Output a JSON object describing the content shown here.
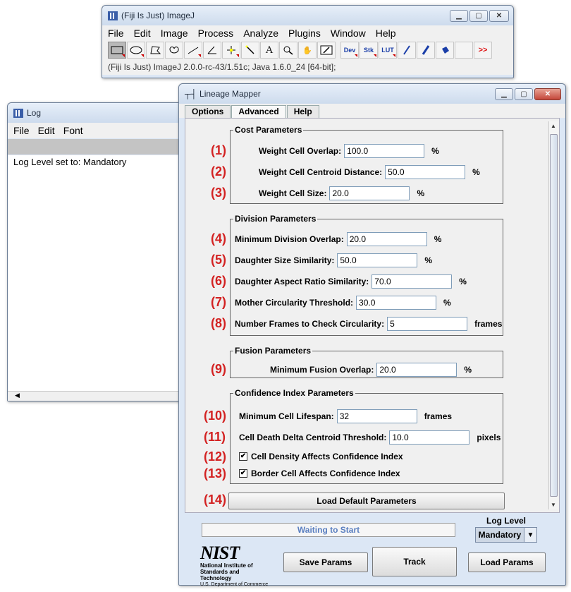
{
  "imagej": {
    "title": "(Fiji Is Just) ImageJ",
    "menu": [
      "File",
      "Edit",
      "Image",
      "Process",
      "Analyze",
      "Plugins",
      "Window",
      "Help"
    ],
    "toolbar": {
      "dev": "Dev",
      "stk": "Stk",
      "lut": "LUT",
      "more": ">>"
    },
    "status": "(Fiji Is Just) ImageJ 2.0.0-rc-43/1.51c; Java 1.6.0_24 [64-bit];"
  },
  "log_window": {
    "title": "Log",
    "menu": [
      "File",
      "Edit",
      "Font"
    ],
    "text": "Log Level set to: Mandatory"
  },
  "lineage_mapper": {
    "title": "Lineage Mapper",
    "tabs": [
      "Options",
      "Advanced",
      "Help"
    ],
    "active_tab": "Advanced",
    "cost": {
      "legend": "Cost Parameters",
      "weight_overlap": {
        "num": "(1)",
        "label": "Weight Cell Overlap:",
        "value": "100.0",
        "unit": "%"
      },
      "weight_centroid": {
        "num": "(2)",
        "label": "Weight Cell Centroid Distance:",
        "value": "50.0",
        "unit": "%"
      },
      "weight_size": {
        "num": "(3)",
        "label": "Weight Cell Size:",
        "value": "20.0",
        "unit": "%"
      }
    },
    "division": {
      "legend": "Division Parameters",
      "min_overlap": {
        "num": "(4)",
        "label": "Minimum Division Overlap:",
        "value": "20.0",
        "unit": "%"
      },
      "daughter_size": {
        "num": "(5)",
        "label": "Daughter Size Similarity:",
        "value": "50.0",
        "unit": "%"
      },
      "daughter_aspect": {
        "num": "(6)",
        "label": "Daughter Aspect Ratio Similarity:",
        "value": "70.0",
        "unit": "%"
      },
      "mother_circ": {
        "num": "(7)",
        "label": "Mother Circularity Threshold:",
        "value": "30.0",
        "unit": "%"
      },
      "frames_circ": {
        "num": "(8)",
        "label": "Number Frames to Check Circularity:",
        "value": "5",
        "unit": "frames"
      }
    },
    "fusion": {
      "legend": "Fusion Parameters",
      "min_overlap": {
        "num": "(9)",
        "label": "Minimum Fusion Overlap:",
        "value": "20.0",
        "unit": "%"
      }
    },
    "confidence": {
      "legend": "Confidence Index Parameters",
      "lifespan": {
        "num": "(10)",
        "label": "Minimum Cell Lifespan:",
        "value": "32",
        "unit": "frames"
      },
      "death_delta": {
        "num": "(11)",
        "label": "Cell Death Delta Centroid Threshold:",
        "value": "10.0",
        "unit": "pixels"
      },
      "density": {
        "num": "(12)",
        "label": "Cell Density Affects Confidence Index",
        "checked": true
      },
      "border": {
        "num": "(13)",
        "label": "Border Cell Affects Confidence Index",
        "checked": true
      }
    },
    "load_defaults": {
      "num": "(14)",
      "label": "Load Default Parameters"
    },
    "status": "Waiting to Start",
    "log_level_label": "Log Level",
    "log_level": "Mandatory",
    "buttons": {
      "save": "Save Params",
      "track": "Track",
      "load": "Load Params"
    },
    "nist": {
      "logo": "NIST",
      "line1": "National Institute of",
      "line2": "Standards and Technology",
      "line3": "U.S. Department of Commerce"
    }
  },
  "colors": {
    "annotation_number": "#d32222",
    "status_text": "#5a7fc0"
  }
}
